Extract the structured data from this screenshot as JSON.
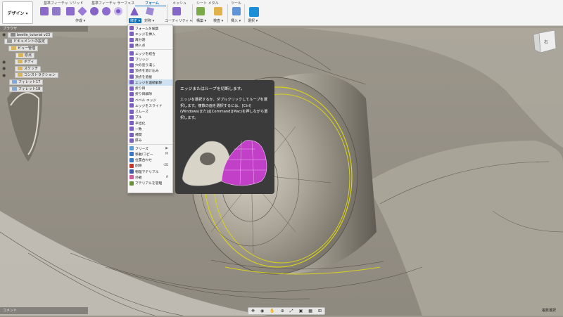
{
  "workspace": {
    "label": "デザイン ▾"
  },
  "tabs": [
    {
      "label": "基準フィーチャ ソリッド"
    },
    {
      "label": "基準フィーチャ サーフェス"
    },
    {
      "label": "フォーム",
      "active": true
    },
    {
      "label": "メッシュ"
    },
    {
      "label": "シート メタル"
    },
    {
      "label": "ツール"
    }
  ],
  "groups": {
    "create": "作成 ▾",
    "modify": "修正 ▾",
    "symmetry": "対称 ▾",
    "utility": "ユーティリティ ▾",
    "construct": "構築 ▾",
    "inspect": "検査 ▾",
    "insert": "挿入 ▾",
    "select": "選択 ▾"
  },
  "browser": {
    "title": "ブラウザ",
    "items": [
      {
        "label": "beetle_tutorial v23",
        "icon": "document-icon"
      },
      {
        "label": "ドキュメントの設定",
        "icon": "gear-icon"
      },
      {
        "label": "ビュー管理",
        "icon": "folder-icon"
      },
      {
        "label": "原点",
        "icon": "folder-icon"
      },
      {
        "label": "ボディ",
        "icon": "folder-icon"
      },
      {
        "label": "スケッチ",
        "icon": "folder-icon"
      },
      {
        "label": "コンストラクション",
        "icon": "folder-icon"
      },
      {
        "label": "フィレット17",
        "icon": "fillet-icon"
      },
      {
        "label": "フィレット18",
        "icon": "fillet-icon"
      }
    ]
  },
  "menu": {
    "items": [
      {
        "label": "フォームを編集",
        "color": "#7a5fc0"
      },
      {
        "label": "エッジを挿入",
        "color": "#7a5fc0"
      },
      {
        "label": "再分割",
        "color": "#7a5fc0"
      },
      {
        "label": "挿入点",
        "color": "#7a5fc0"
      },
      {
        "sep": true
      },
      {
        "label": "エッジを結合",
        "color": "#7a5fc0"
      },
      {
        "label": "ブリッジ",
        "color": "#7a5fc0"
      },
      {
        "label": "穴の塗り潰し",
        "color": "#7a5fc0"
      },
      {
        "label": "頂点を溶け込み",
        "color": "#7a5fc0"
      },
      {
        "label": "頂点を溶接",
        "color": "#7a5fc0"
      },
      {
        "label": "エッジを連続解除",
        "color": "#7a5fc0",
        "highlight": true
      },
      {
        "label": "折り目",
        "color": "#7a5fc0"
      },
      {
        "label": "折り目解除",
        "color": "#7a5fc0"
      },
      {
        "label": "ベベル エッジ",
        "color": "#7a5fc0"
      },
      {
        "label": "エッジをスライド",
        "color": "#7a5fc0"
      },
      {
        "label": "スムーズ",
        "color": "#7a5fc0"
      },
      {
        "label": "プル",
        "color": "#7a5fc0"
      },
      {
        "label": "平坦化",
        "color": "#7a5fc0"
      },
      {
        "label": "一致",
        "color": "#7a5fc0"
      },
      {
        "label": "補間",
        "color": "#7a5fc0"
      },
      {
        "label": "厚み",
        "color": "#7a5fc0"
      },
      {
        "sep": true
      },
      {
        "label": "フリーズ",
        "color": "#5a9ad5",
        "arrow": "▶"
      },
      {
        "label": "移動/コピー",
        "color": "#3a78c5",
        "shortcut": "M"
      },
      {
        "label": "位置合わせ",
        "color": "#3a78c5"
      },
      {
        "label": "削除",
        "color": "#c0392b",
        "shortcut": "⌫"
      },
      {
        "label": "物理マテリアル",
        "color": "#3e5fa8"
      },
      {
        "label": "外観",
        "color": "#d45a9b",
        "shortcut": "A"
      },
      {
        "label": "マテリアルを管理",
        "color": "#6a8f3a"
      }
    ]
  },
  "tooltip": {
    "title": "エッジまたはループを切断します。",
    "body": "エッジを選択するか、ダブルクリックしてループを選択します。複数の面を選択するには、[Ctrl](Windows)または[Command](Mac)を押しながら選択します。",
    "left_model_color": "#d8d4c8",
    "right_model_color": "#c23fc8"
  },
  "comment_bar": {
    "label": "コメント"
  },
  "status": {
    "label": "複数選択"
  },
  "viewcube": {
    "label": "右"
  }
}
